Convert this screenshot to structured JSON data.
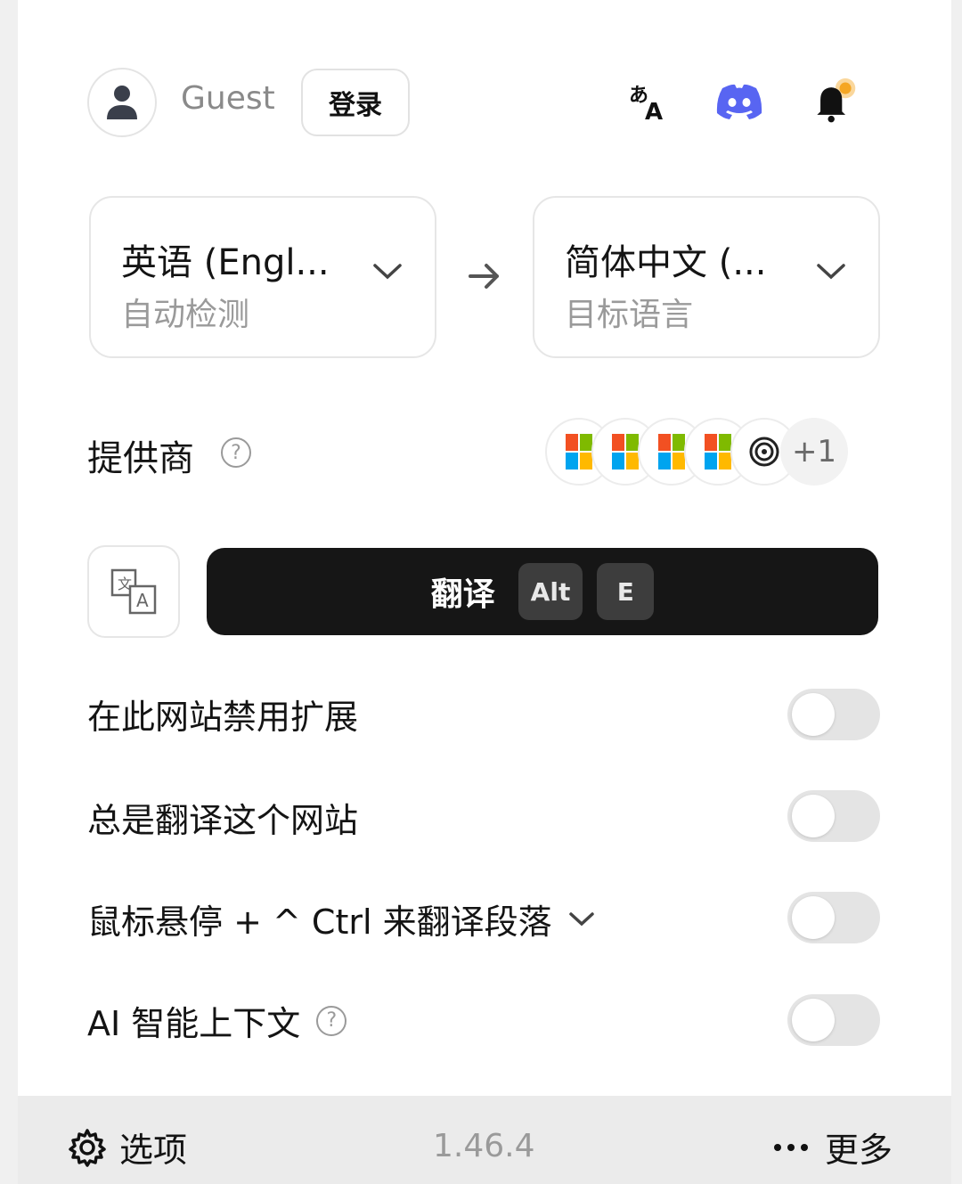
{
  "header": {
    "guest_label": "Guest",
    "login_label": "登录"
  },
  "languages": {
    "source_name": "英语 (Engl...",
    "source_sub": "自动检测",
    "target_name": "简体中文 (...",
    "target_sub": "目标语言"
  },
  "providers": {
    "label": "提供商",
    "help": "?",
    "more_count": "+1"
  },
  "translate": {
    "label": "翻译",
    "key1": "Alt",
    "key2": "E"
  },
  "settings": [
    {
      "label": "在此网站禁用扩展",
      "enabled": false
    },
    {
      "label": "总是翻译这个网站",
      "enabled": false
    },
    {
      "label": "鼠标悬停 + ^ Ctrl 来翻译段落",
      "enabled": false
    },
    {
      "label": "AI 智能上下文",
      "enabled": false
    }
  ],
  "footer": {
    "options_label": "选项",
    "version": "1.46.4",
    "more_label": "更多"
  },
  "colors": {
    "discord": "#5865f2",
    "primary_button": "#161616",
    "notify_dot": "#f5a623"
  }
}
